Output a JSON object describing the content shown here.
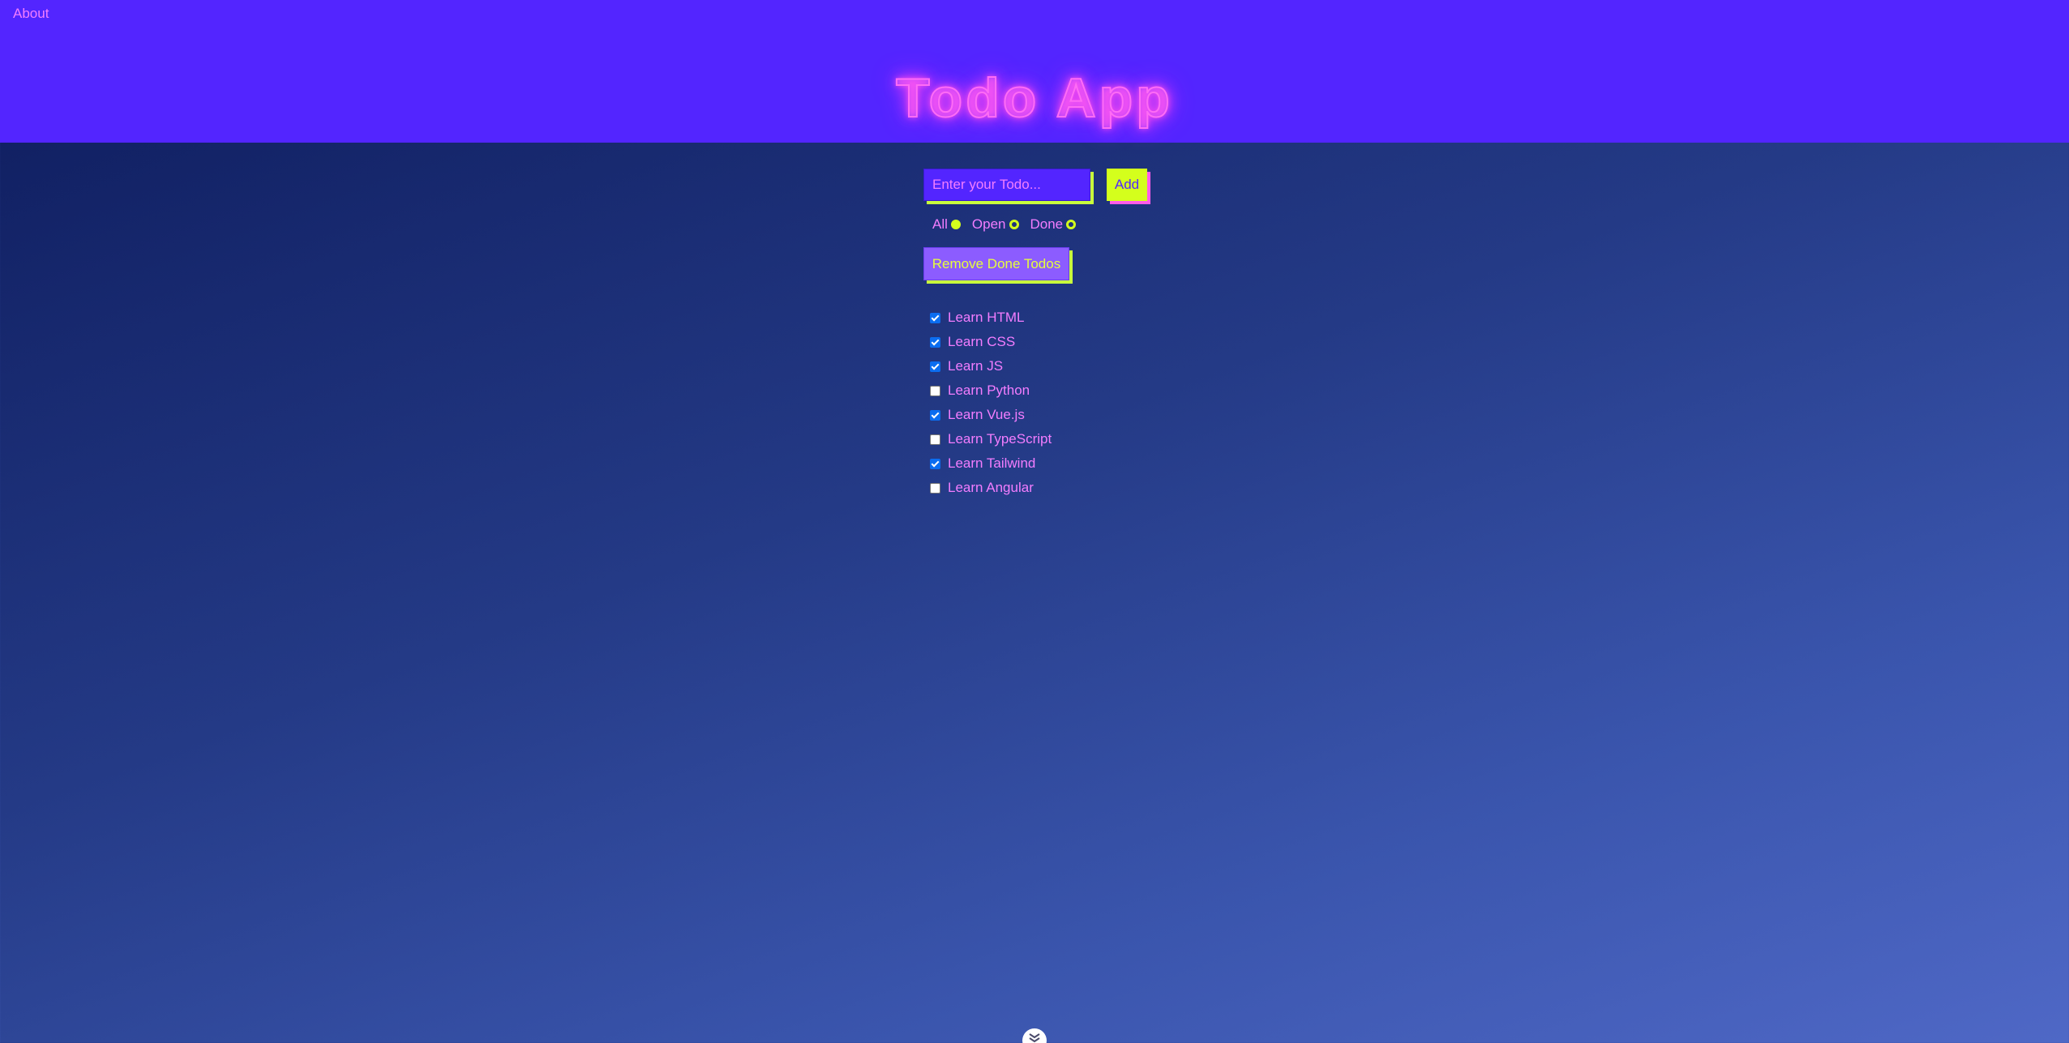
{
  "nav": {
    "about_label": "About"
  },
  "header": {
    "title": "Todo App"
  },
  "form": {
    "input_placeholder": "Enter your Todo...",
    "input_value": "",
    "add_label": "Add"
  },
  "filters": [
    {
      "label": "All",
      "selected": true
    },
    {
      "label": "Open",
      "selected": false
    },
    {
      "label": "Done",
      "selected": false
    }
  ],
  "remove_done_label": "Remove Done Todos",
  "todos": [
    {
      "text": "Learn HTML",
      "done": true
    },
    {
      "text": "Learn CSS",
      "done": true
    },
    {
      "text": "Learn JS",
      "done": true
    },
    {
      "text": "Learn Python",
      "done": false
    },
    {
      "text": "Learn Vue.js",
      "done": true
    },
    {
      "text": "Learn TypeScript",
      "done": false
    },
    {
      "text": "Learn Tailwind",
      "done": true
    },
    {
      "text": "Learn Angular",
      "done": false
    }
  ],
  "icons": {
    "scroll_button": "chevron-double-down-icon"
  },
  "colors": {
    "header_bg": "#5325ff",
    "text_pink": "#f37dff",
    "accent_lime": "#d4ff1c",
    "checkbox_blue": "#0b6df0",
    "remove_button_bg": "#8c5cff"
  }
}
